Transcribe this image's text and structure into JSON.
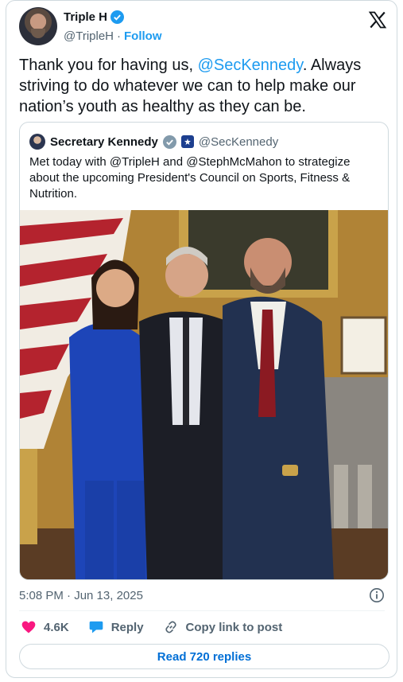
{
  "author": {
    "name": "Triple H",
    "handle": "@TripleH",
    "separator": "·",
    "follow_label": "Follow"
  },
  "tweet": {
    "text_before": "Thank you for having us, ",
    "mention": "@SecKennedy",
    "text_after": ". Always striving to do whatever we can to help make our nation’s youth as healthy as they can be."
  },
  "quoted": {
    "name": "Secretary Kennedy",
    "handle": "@SecKennedy",
    "text": "Met today with @TripleH and @StephMcMahon to strategize about the upcoming President's Council on Sports, Fitness & Nutrition."
  },
  "meta": {
    "timestamp": "5:08 PM · Jun 13, 2025"
  },
  "actions": {
    "like_count": "4.6K",
    "reply_label": "Reply",
    "copy_label": "Copy link to post"
  },
  "read_replies_label": "Read 720 replies",
  "colors": {
    "accent": "#1d9bf0",
    "like": "#f91880",
    "text": "#0f1419",
    "secondary": "#536471"
  },
  "icons": [
    "verified-badge-icon",
    "x-logo-icon",
    "government-badge-icon",
    "info-icon",
    "heart-icon",
    "reply-bubble-icon",
    "link-icon"
  ]
}
